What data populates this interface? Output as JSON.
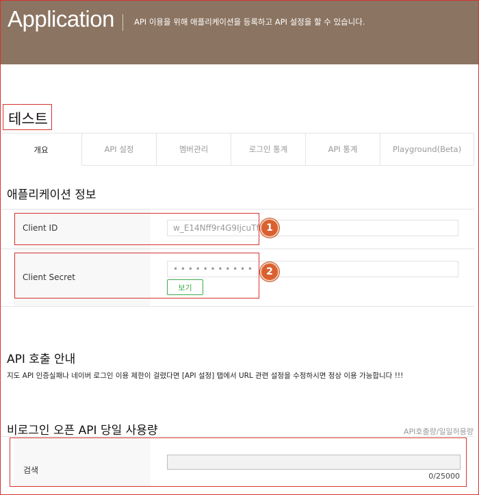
{
  "header": {
    "title": "Application",
    "description": "API 이용을 위해 애플리케이션을 등록하고 API 설정을 할 수 있습니다."
  },
  "app": {
    "name": "테스트"
  },
  "tabs": [
    {
      "label": "개요",
      "active": true
    },
    {
      "label": "API 설정",
      "active": false
    },
    {
      "label": "멤버관리",
      "active": false
    },
    {
      "label": "로그인 통계",
      "active": false
    },
    {
      "label": "API 통계",
      "active": false
    },
    {
      "label": "Playground(Beta)",
      "active": false
    }
  ],
  "app_info": {
    "title": "애플리케이션 정보",
    "client_id_label": "Client ID",
    "client_id_value": "w_E14Nff9r4G9IjcuTfX",
    "client_secret_label": "Client Secret",
    "client_secret_value": "• • • • • • • • • • •",
    "view_button": "보기"
  },
  "annotations": {
    "badge1": "1",
    "badge2": "2",
    "color": "#d9612f"
  },
  "api_call": {
    "title": "API 호출 안내",
    "notice": "지도 API 인증실패나 네이버 로그인 이용 제한이 걸렸다면 [API 설정] 탭에서 URL 관련 설정을 수정하시면 정상 이용 가능합니다 !!!"
  },
  "usage": {
    "title": "비로그인 오픈 API 당일 사용량",
    "subtitle": "API호출량/일일허용량",
    "row_label": "검색",
    "count_text": "0/25000",
    "used": 0,
    "limit": 25000
  },
  "colors": {
    "header_bg": "#8b7461",
    "accent_green": "#3cab4b",
    "highlight_red": "#d6322e"
  }
}
